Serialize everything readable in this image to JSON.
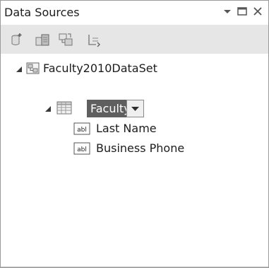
{
  "panel": {
    "title": "Data Sources",
    "controls": [
      {
        "icon": "pin-dropdown-icon"
      },
      {
        "icon": "maximize-icon"
      },
      {
        "icon": "close-icon"
      }
    ]
  },
  "toolbar": {
    "buttons": [
      {
        "icon": "add-data-source-icon"
      },
      {
        "icon": "edit-dataset-designer-icon"
      },
      {
        "icon": "configure-dataset-icon"
      },
      {
        "icon": "refresh-icon"
      }
    ]
  },
  "tree": {
    "root": {
      "label": "Faculty2010DataSet",
      "icon": "dataset-icon",
      "expanded": true
    },
    "table": {
      "label": "Faculty",
      "icon": "datagrid-icon",
      "expanded": true,
      "selected": true
    },
    "fields": [
      {
        "label": "Last Name",
        "icon": "textbox-field-icon",
        "icon_text": "abl"
      },
      {
        "label": "Business Phone",
        "icon": "textbox-field-icon",
        "icon_text": "abl"
      }
    ]
  },
  "colors": {
    "toolbar_bg": "#e6e6e6",
    "selection_bg": "#5f5f5f",
    "text": "#1c1c1c"
  }
}
